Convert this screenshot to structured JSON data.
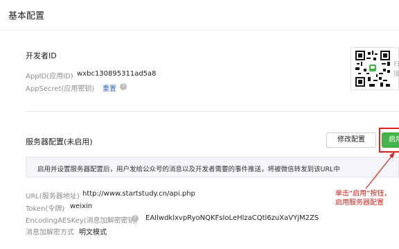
{
  "header": {
    "title": "基本配置"
  },
  "developer": {
    "section_title": "开发者ID",
    "appid_label": "AppID(应用ID)",
    "appid_value": "wxbc130895311ad5a8",
    "secret_label": "AppSecret(应用密钥)",
    "secret_action": "重置",
    "help_glyph": "?",
    "qr_side_text": [
      "扫",
      "接"
    ]
  },
  "server": {
    "section_title": "服务器配置(未启用)",
    "modify_button": "修改配置",
    "enable_button": "启用",
    "notice": "启用并设置服务器配置后，用户发给公众号的消息以及开发者需要的事件推送，将被微信转发到该URL中",
    "url_label": "URL(服务器地址)",
    "url_value": "http://www.startstudy.cn/api.php",
    "token_label": "Token(令牌)",
    "token_value": "weixin",
    "aes_label": "EncodingAESKey(消息加解密密钥)",
    "aes_help_glyph": "?",
    "aes_value": "EAIlwdklxvpRyoNQKFsIoLeHlzaCQtl6zuXaVYjM2ZS",
    "mode_label": "消息加解密方式",
    "mode_value": "明文模式"
  },
  "annotation": {
    "line1": "单击“启用”按钮，",
    "line2": "启用服务器配置"
  },
  "colors": {
    "accent_green": "#44b549",
    "annotation_red": "#d9221c",
    "link_blue": "#2a67c2"
  },
  "icons": [
    "qr-code-icon",
    "help-icon"
  ]
}
